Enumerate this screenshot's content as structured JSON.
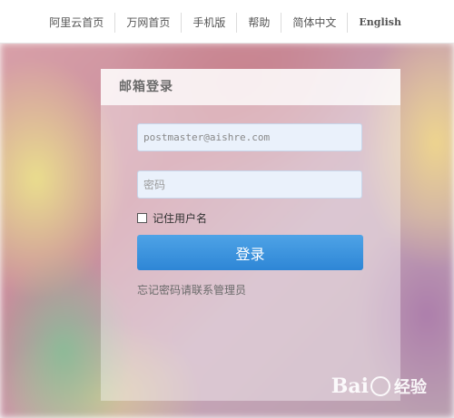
{
  "nav": {
    "items": [
      "阿里云首页",
      "万网首页",
      "手机版",
      "帮助",
      "简体中文",
      "English"
    ]
  },
  "login": {
    "title": "邮箱登录",
    "username_value": "postmaster@aishre.com",
    "password_placeholder": "密码",
    "remember_label": "记住用户名",
    "submit_label": "登录",
    "forgot_text": "忘记密码请联系管理员"
  },
  "watermark": {
    "text": "Bai经验"
  },
  "colors": {
    "accent": "#3a93de",
    "input_bg": "#eaf1fb"
  },
  "icons": [
    "checkbox-icon",
    "baidu-paw-icon"
  ]
}
